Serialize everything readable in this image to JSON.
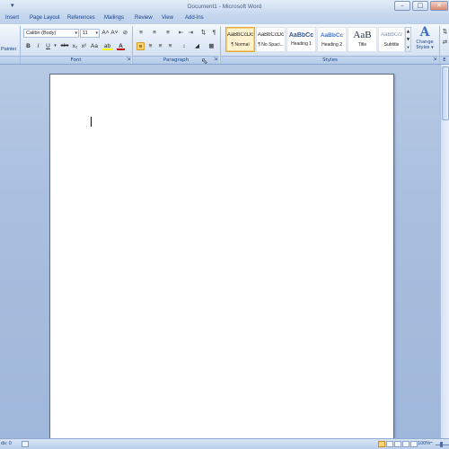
{
  "window": {
    "title": "Document1 - Microsoft Word"
  },
  "tabs": [
    "Insert",
    "Page Layout",
    "References",
    "Mailings",
    "Review",
    "View",
    "Add-Ins"
  ],
  "clipboard": {
    "painter_label": "Painter"
  },
  "font": {
    "group_label": "Font",
    "font_name": "Calibri (Body)",
    "font_size": "11",
    "grow_icon": "A˄",
    "shrink_icon": "A˅",
    "clear_icon": "⊘",
    "bold": "B",
    "italic": "I",
    "underline": "U",
    "strike": "abc",
    "subscript": "x₂",
    "superscript": "x²",
    "change_case": "Aa",
    "highlight": "ab",
    "font_color": "A"
  },
  "paragraph": {
    "group_label": "Paragraph",
    "pilcrow": "¶"
  },
  "styles": {
    "group_label": "Styles",
    "items": [
      {
        "sample": "AaBbCcDc",
        "name": "¶ Normal",
        "selected": true
      },
      {
        "sample": "AaBbCcDc",
        "name": "¶ No Spaci...",
        "selected": false
      },
      {
        "sample": "AaBbCc",
        "name": "Heading 1",
        "selected": false
      },
      {
        "sample": "AaBbCc",
        "name": "Heading 2",
        "selected": false
      },
      {
        "sample": "AaB",
        "name": "Title",
        "selected": false
      },
      {
        "sample": "AaBbCcI",
        "name": "Subtitle",
        "selected": false
      }
    ],
    "change_styles_label1": "Change",
    "change_styles_label2": "Styles ▾",
    "gallery_up": "▲",
    "gallery_down": "▼",
    "gallery_more": "▾"
  },
  "editing": {
    "partial_label": "E"
  },
  "statusbar": {
    "words": "ds: 0",
    "zoom": "100%",
    "zoom_minus": "−"
  },
  "colors": {
    "highlight": "#ffff00",
    "font_color": "#c00000",
    "accent": "#15428b"
  }
}
